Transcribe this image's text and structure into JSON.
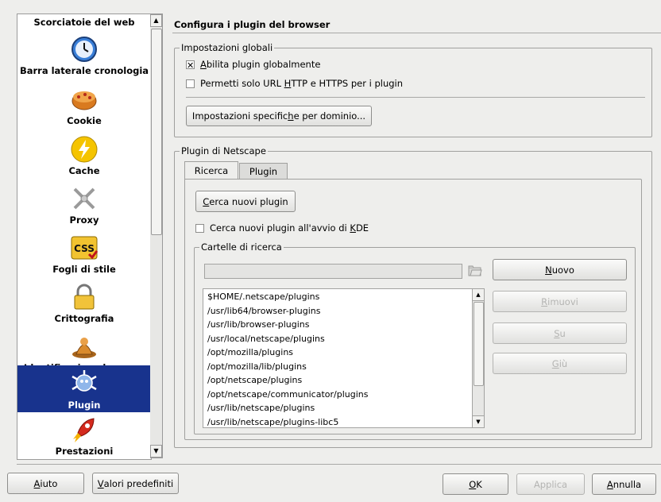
{
  "sidebar": {
    "items": [
      {
        "label": "Scorciatoie del web",
        "icon": "web-shortcuts-icon"
      },
      {
        "label": "Barra laterale cronologia",
        "icon": "history-clock-icon"
      },
      {
        "label": "Cookie",
        "icon": "cookie-icon"
      },
      {
        "label": "Cache",
        "icon": "cache-lightning-icon"
      },
      {
        "label": "Proxy",
        "icon": "proxy-icon"
      },
      {
        "label": "Fogli di stile",
        "icon": "css-icon",
        "icon_text": "CSS"
      },
      {
        "label": "Crittografia",
        "icon": "lock-icon"
      },
      {
        "label": "Identificazione browser",
        "icon": "browser-id-icon"
      },
      {
        "label": "Plugin",
        "icon": "plugin-icon",
        "selected": true
      },
      {
        "label": "Prestazioni",
        "icon": "rocket-icon"
      }
    ],
    "selected_color": "#18338d"
  },
  "page": {
    "title": "Configura i plugin del browser"
  },
  "global": {
    "title": "Impostazioni globali",
    "enable_plugins": {
      "pre": "",
      "u": "A",
      "post": "bilita plugin globalmente",
      "checked": true
    },
    "http_only": {
      "pre": "Permetti solo URL ",
      "u": "H",
      "post": "TTP e HTTPS per i plugin",
      "checked": false
    },
    "domain_button": {
      "pre": "Impostazioni specific",
      "u": "h",
      "post": "e per dominio..."
    }
  },
  "netscape": {
    "title": "Plugin di Netscape",
    "tabs": [
      {
        "label": "Ricerca",
        "active": true
      },
      {
        "label": "Plugin",
        "active": false
      }
    ],
    "search_button": {
      "pre": "",
      "u": "C",
      "post": "erca nuovi plugin"
    },
    "search_on_start": {
      "pre": "Cerca nuovi plugin all'avvio di ",
      "u": "K",
      "post": "DE",
      "checked": false
    },
    "folders": {
      "title": "Cartelle di ricerca",
      "input_value": "",
      "paths": [
        "$HOME/.netscape/plugins",
        "/usr/lib64/browser-plugins",
        "/usr/lib/browser-plugins",
        "/usr/local/netscape/plugins",
        "/opt/mozilla/plugins",
        "/opt/mozilla/lib/plugins",
        "/opt/netscape/plugins",
        "/opt/netscape/communicator/plugins",
        "/usr/lib/netscape/plugins",
        "/usr/lib/netscape/plugins-libc5"
      ],
      "buttons": {
        "new": {
          "pre": "",
          "u": "N",
          "post": "uovo"
        },
        "remove": {
          "pre": "",
          "u": "R",
          "post": "imuovi"
        },
        "up": {
          "pre": "",
          "u": "S",
          "post": "u"
        },
        "down": {
          "pre": "",
          "u": "G",
          "post": "iù"
        }
      }
    }
  },
  "footer": {
    "help": {
      "pre": "",
      "u": "A",
      "post": "iuto"
    },
    "defaults": {
      "pre": "",
      "u": "V",
      "post": "alori predefiniti"
    },
    "ok": {
      "pre": "",
      "u": "O",
      "post": "K"
    },
    "apply": {
      "pre": "Applica",
      "u": "",
      "post": ""
    },
    "cancel": {
      "pre": "",
      "u": "A",
      "post": "nnulla"
    }
  }
}
